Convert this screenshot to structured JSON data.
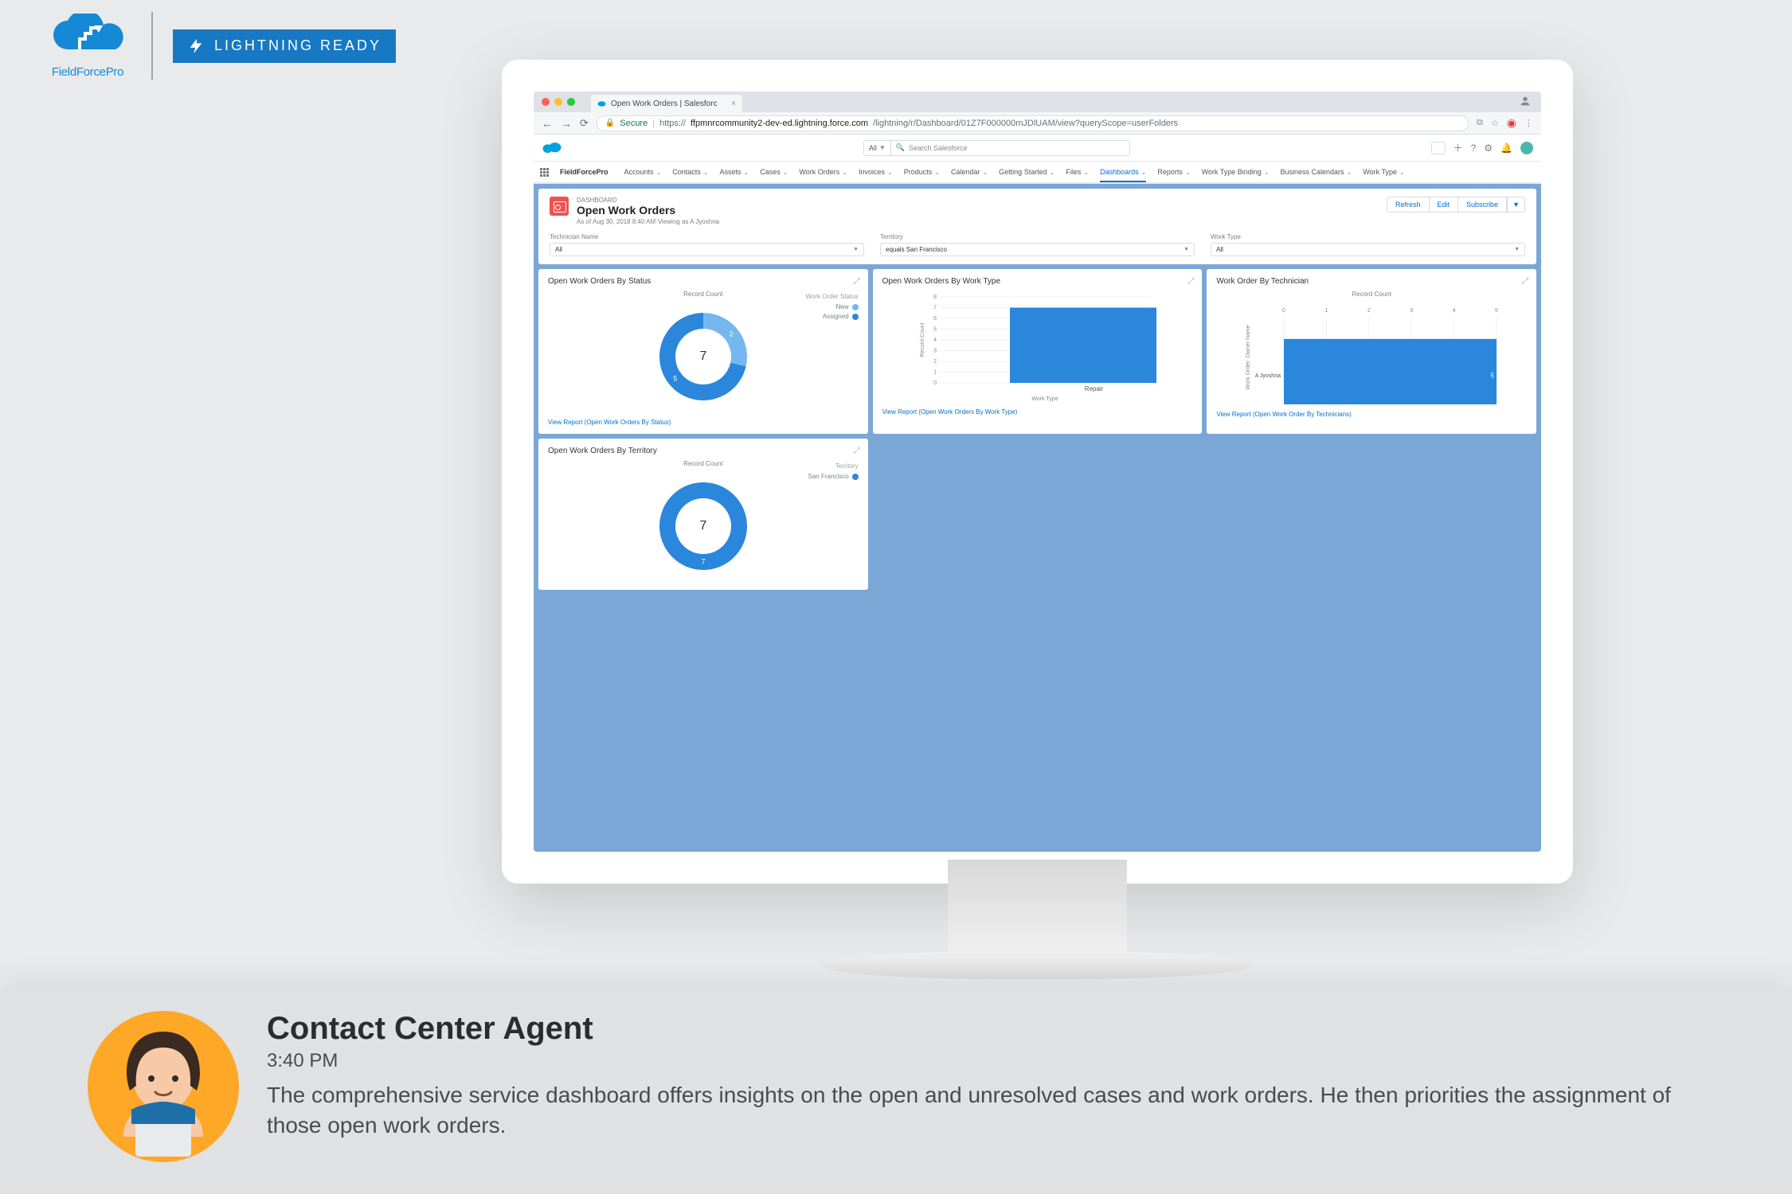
{
  "logo": {
    "name": "FieldForcePro"
  },
  "lightning_badge": "LIGHTNING READY",
  "browser": {
    "tab_title": "Open Work Orders | Salesforc",
    "secure_label": "Secure",
    "url_prefix": "https://",
    "url_bold": "ffpmnrcommunity2-dev-ed.lightning.force.com",
    "url_rest": "/lightning/r/Dashboard/01Z7F000000mJDlUAM/view?queryScope=userFolders"
  },
  "sf_header": {
    "all_label": "All",
    "search_placeholder": "Search Salesforce"
  },
  "nav": {
    "brand": "FieldForcePro",
    "items": [
      "Accounts",
      "Contacts",
      "Assets",
      "Cases",
      "Work Orders",
      "Invoices",
      "Products",
      "Calendar",
      "Getting Started",
      "Files",
      "Dashboards",
      "Reports",
      "Work Type Binding",
      "Business Calendars",
      "Work Type"
    ],
    "active_index": 10
  },
  "dashboard": {
    "eyebrow": "DASHBOARD",
    "title": "Open Work Orders",
    "subtitle": "As of Aug 30, 2018 8:40 AM·Viewing as A Jyoshna",
    "actions": {
      "refresh": "Refresh",
      "edit": "Edit",
      "subscribe": "Subscribe",
      "more": "▼"
    },
    "filters": [
      {
        "label": "Technician Name",
        "value": "All"
      },
      {
        "label": "Territory",
        "value": "equals San Francisco"
      },
      {
        "label": "Work Type",
        "value": "All"
      }
    ]
  },
  "chart_data": [
    {
      "id": "status",
      "type": "pie",
      "title": "Open Work Orders By Status",
      "subtitle": "Record Count",
      "legend_title": "Work Order Status",
      "series": [
        {
          "name": "New",
          "value": 2,
          "color": "#75b8f0"
        },
        {
          "name": "Assigned",
          "value": 5,
          "color": "#2a87db"
        }
      ],
      "center_value": 7,
      "view_report": "View Report (Open Work Orders By Status)"
    },
    {
      "id": "worktype",
      "type": "bar",
      "title": "Open Work Orders By Work Type",
      "xlabel": "Work Type",
      "ylabel": "Record Count",
      "categories": [
        "Repair"
      ],
      "values": [
        7
      ],
      "ylim": [
        0,
        8
      ],
      "yticks": [
        0,
        1,
        2,
        3,
        4,
        5,
        6,
        7,
        8
      ],
      "color": "#2a87db",
      "view_report": "View Report (Open Work Orders By Work Type)"
    },
    {
      "id": "technician",
      "type": "bar",
      "orientation": "horizontal",
      "title": "Work Order By Technician",
      "subtitle": "Record Count",
      "ylabel": "Work Order: Owner Name",
      "categories": [
        "A Jyoshna"
      ],
      "values": [
        5
      ],
      "xlim": [
        0,
        5
      ],
      "xticks": [
        0,
        1,
        2,
        3,
        4,
        5
      ],
      "color": "#2a87db",
      "view_report": "View Report (Open Work Order By Technicians)"
    },
    {
      "id": "territory",
      "type": "pie",
      "title": "Open Work Orders By Territory",
      "subtitle": "Record Count",
      "legend_title": "Territory",
      "series": [
        {
          "name": "San Francisco",
          "value": 7,
          "color": "#2a87db"
        }
      ],
      "center_value": 7,
      "view_report": ""
    }
  ],
  "persona": {
    "name": "Contact Center Agent",
    "time": "3:40 PM",
    "blurb": "The comprehensive service dashboard offers insights on the open and unresolved cases and work orders. He then priorities the assignment of those open work orders."
  }
}
